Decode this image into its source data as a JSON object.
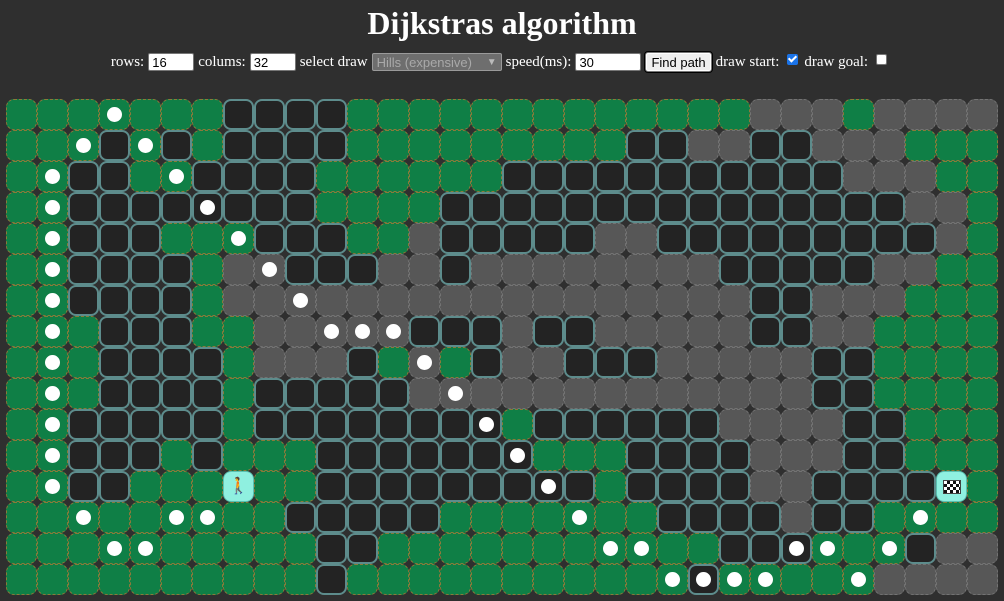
{
  "title": "Dijkstras algorithm",
  "controls": {
    "rows_label": "rows:",
    "rows_value": "16",
    "cols_label": "colums:",
    "cols_value": "32",
    "select_label": "select draw",
    "select_value": "Hills (expensive)",
    "speed_label": "speed(ms):",
    "speed_value": "30",
    "find_button": "Find path",
    "draw_start_label": "draw start:",
    "draw_start_checked": true,
    "draw_goal_label": "draw goal:",
    "draw_goal_checked": false
  },
  "grid": {
    "rows": 16,
    "cols": 32,
    "legend": {
      "g": "grass",
      "b": "wall",
      "m": "hill",
      "l": "hill",
      "s": "start",
      "e": "goal"
    },
    "cells": [
      "gggggggbbbbgggggggggggggmmmgmmmm",
      "gggbgbgbbbbgggggggggbbmmbbmmmggg",
      "ggbbggbbbbggggggbbbbbbbbbbbmmmgg",
      "ggbbbbbbbbggggbbbbbbbbbbbbbbbmmg",
      "ggbbbgggbbbggmbbbbbmmbbbbbbbbbmg",
      "ggbbbbgmmbbbmmbmmmmmmmmbbbbbmmgg",
      "ggbbbbgmmmmmmmmmmmmmmmmmbbmmmgg",
      "gggbbbggmmmmmbbbmbbmmmmmbbmmgg",
      "gggbbbbgmmmbgmgbmmbbbmmmmmbbggg",
      "gggbbbbgbbbbbmmmmmmmmmmmmmbbggg",
      "ggbbbbbgbbbbbbbbgbbbbbbmmmmbbgg",
      "ggbbbgbgggbbbbbbbgggbbbbmmmbbggg",
      "ggbbgggsggbbbbbbbbbgbbbbmmbbbbeg",
      "gggggggggbbbbbgggggggbbbbmbbggg",
      "ggggggggggbbgggggggggggbbbgggbmm",
      "ggggggggggbgggggggggggbgggggmmmm"
    ],
    "path": [
      [
        0,
        3
      ],
      [
        1,
        2
      ],
      [
        1,
        4
      ],
      [
        2,
        1
      ],
      [
        2,
        5
      ],
      [
        3,
        1
      ],
      [
        3,
        6
      ],
      [
        4,
        1
      ],
      [
        4,
        7
      ],
      [
        5,
        1
      ],
      [
        5,
        8
      ],
      [
        6,
        1
      ],
      [
        6,
        9
      ],
      [
        7,
        1
      ],
      [
        7,
        10
      ],
      [
        7,
        11
      ],
      [
        7,
        12
      ],
      [
        8,
        1
      ],
      [
        8,
        13
      ],
      [
        9,
        1
      ],
      [
        9,
        14
      ],
      [
        10,
        1
      ],
      [
        10,
        15
      ],
      [
        11,
        1
      ],
      [
        11,
        16
      ],
      [
        12,
        1
      ],
      [
        12,
        17
      ],
      [
        13,
        2
      ],
      [
        13,
        5
      ],
      [
        13,
        6
      ],
      [
        13,
        18
      ],
      [
        13,
        29
      ],
      [
        14,
        3
      ],
      [
        14,
        4
      ],
      [
        14,
        19
      ],
      [
        14,
        20
      ],
      [
        14,
        25
      ],
      [
        14,
        26
      ],
      [
        14,
        28
      ],
      [
        15,
        21
      ],
      [
        15,
        22
      ],
      [
        15,
        23
      ],
      [
        15,
        24
      ],
      [
        15,
        27
      ]
    ]
  }
}
